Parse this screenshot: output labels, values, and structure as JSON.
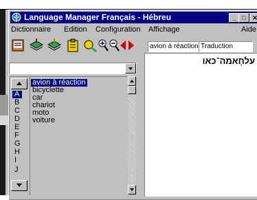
{
  "window": {
    "title": "Language Manager Français - Hébreu",
    "controls": [
      "_",
      "□",
      "✕"
    ]
  },
  "menubar": {
    "items": [
      "Dictionnaire",
      "Edition",
      "Configuration",
      "Affichage"
    ],
    "help": "Aide"
  },
  "toolbar": {
    "icons": [
      "dictionary-icon",
      "book-icon",
      "book-green-icon",
      "clipboard-icon",
      "tools-icon",
      "search-plus-icon",
      "search-minus-icon",
      "prev-arrow-icon",
      "next-arrow-icon"
    ],
    "word_field": "avion à réaction",
    "translation_field": "Traduction"
  },
  "letters": [
    "A",
    "B",
    "C",
    "D",
    "E",
    "F",
    "G",
    "H",
    "I",
    "J"
  ],
  "selected_letter": "A",
  "words": [
    "avion à réaction",
    "bicyclette",
    "car",
    "chariot",
    "moto",
    "voiture"
  ],
  "selected_word": "avion à réaction",
  "translation": "עלחָאמה־כאו",
  "colors": {
    "titlebar": "#000080",
    "face": "#c0c0c0",
    "selection": "#000080"
  }
}
